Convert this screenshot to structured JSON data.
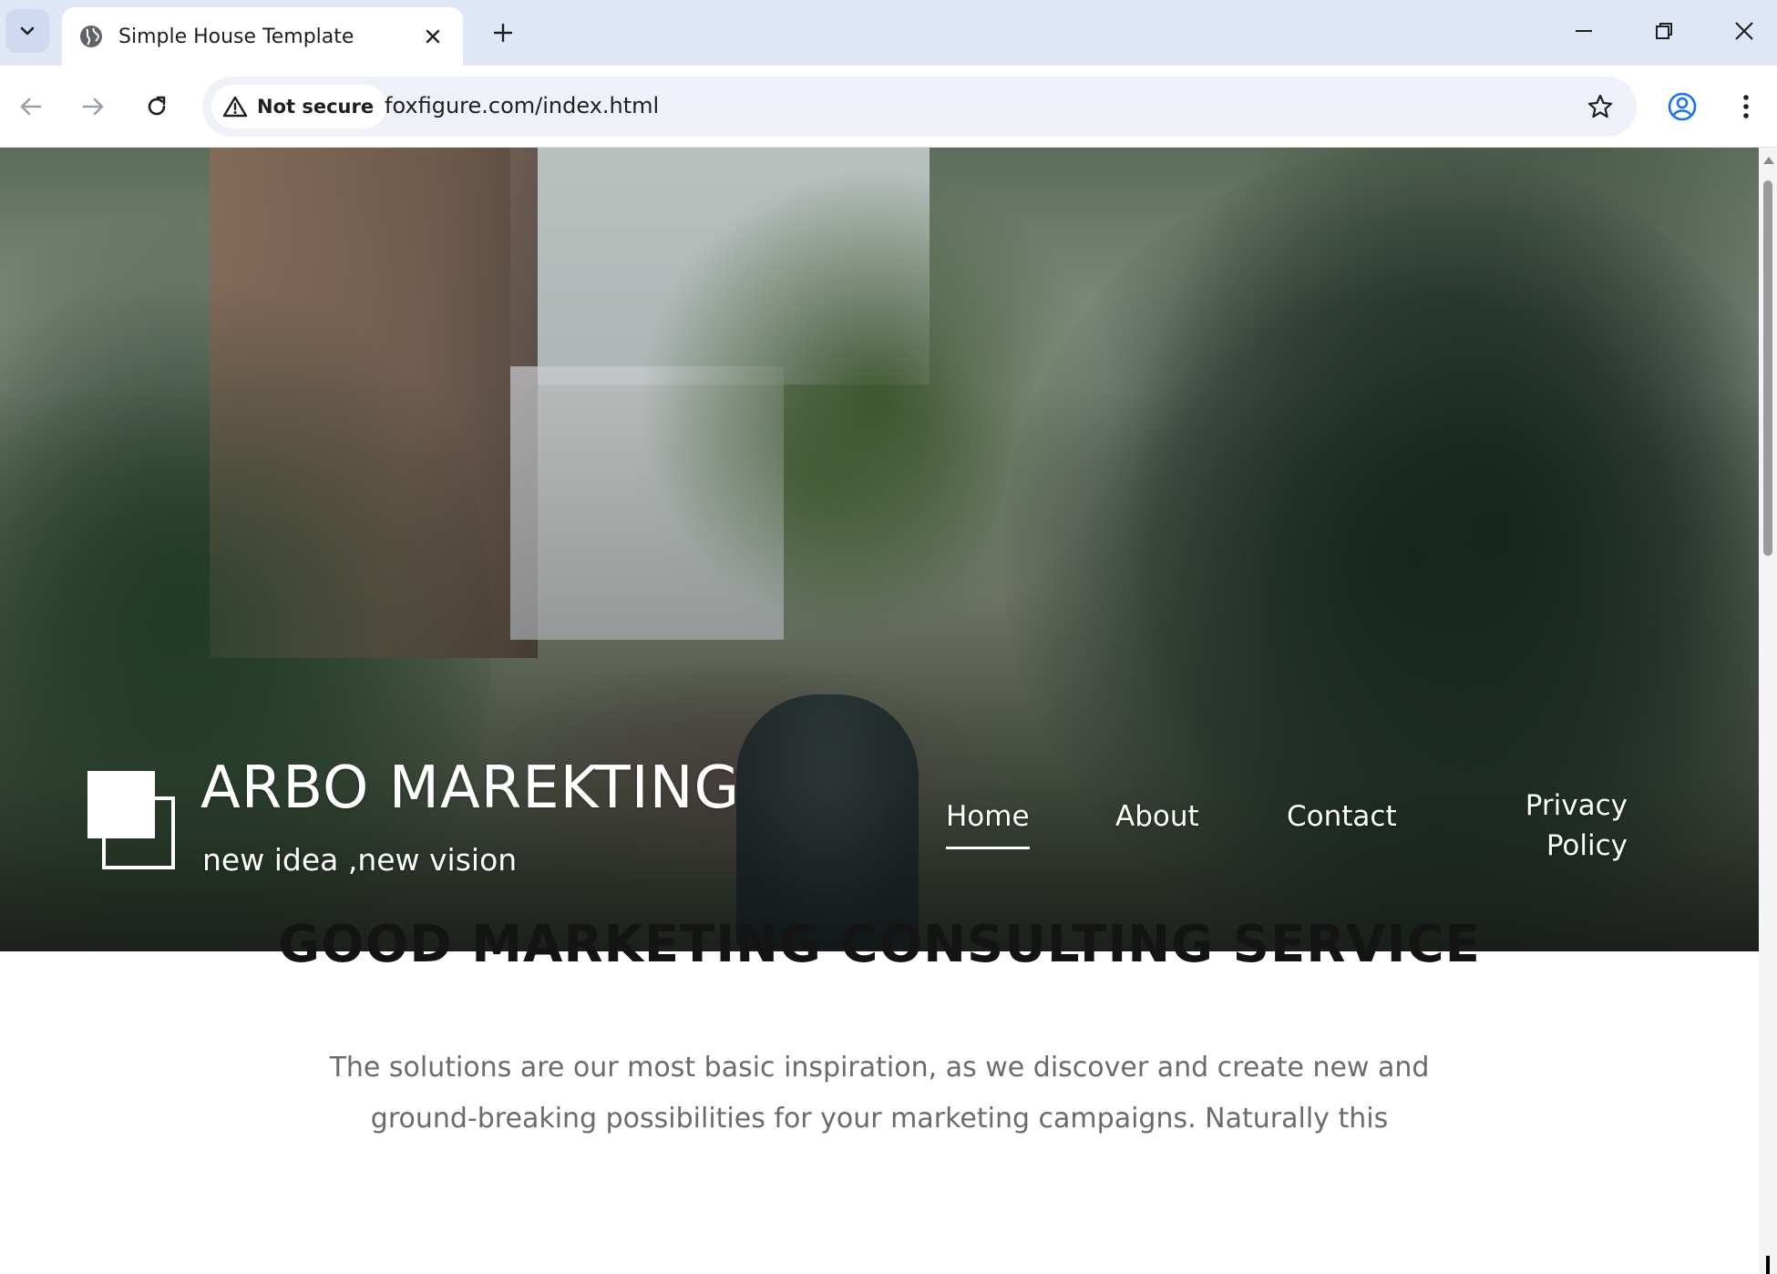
{
  "browser": {
    "tab_title": "Simple House Template",
    "security_label": "Not secure",
    "url": "foxfigure.com/index.html"
  },
  "site": {
    "brand": "ARBO MAREKTING",
    "tagline": "new idea ,new vision",
    "nav": {
      "home": "Home",
      "about": "About",
      "contact": "Contact",
      "privacy_line1": "Privacy",
      "privacy_line2": "Policy"
    },
    "active_nav": "Home",
    "section_title": "GOOD MARKETING CONSULTING SERVICE",
    "section_text": "The solutions are our most basic inspiration, as we discover and create new and ground-breaking possibilities for your marketing campaigns. Naturally this"
  }
}
